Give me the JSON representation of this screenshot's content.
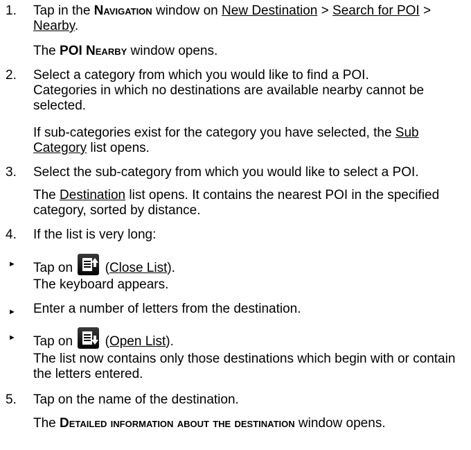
{
  "steps": {
    "s1": {
      "num": "1.",
      "a": "Tap in the ",
      "nav": "Navigation",
      "b": " window on ",
      "l1": "New Destination",
      "sep1": " > ",
      "l2": "Search for POI",
      "sep2": " > ",
      "l3": "Nearby",
      "end": ".",
      "res_bold": "POI Nearby",
      "res_rest": " window opens."
    },
    "s2": {
      "num": "2.",
      "line1": "Select a category from which you would like to find a POI.",
      "line2": "Categories in which no destinations are available nearby cannot be selected.",
      "cond": "If sub-categories exist for the category you have selected, the ",
      "link": "Sub Category",
      "cond_end": " list opens."
    },
    "s3": {
      "num": "3.",
      "text": "Select the sub-category from which you would like to select a POI.",
      "link": "Destination",
      "res": " list opens. It contains the nearest POI in the specified category, sorted by distance."
    },
    "s4": {
      "num": "4.",
      "text": "If the list is very long:"
    },
    "bullets": {
      "b1": {
        "pre": "Tap on ",
        "paren_open": " (",
        "link": "Close List",
        "paren_close": ").",
        "res": "The keyboard appears.",
        "icon": "close-list-icon"
      },
      "b2": {
        "text": "Enter a number of letters from the destination."
      },
      "b3": {
        "pre": "Tap on ",
        "paren_open": " (",
        "link": "Open List",
        "paren_close": ").",
        "res": "The list now contains only those destinations which begin with or contain the letters entered.",
        "icon": "open-list-icon"
      }
    },
    "s5": {
      "num": "5.",
      "text": "Tap on the name of the destination.",
      "res_pre": "The ",
      "res_bold": "Detailed information about the destination",
      "res_post": " window opens."
    }
  },
  "bullet_glyph": "►"
}
